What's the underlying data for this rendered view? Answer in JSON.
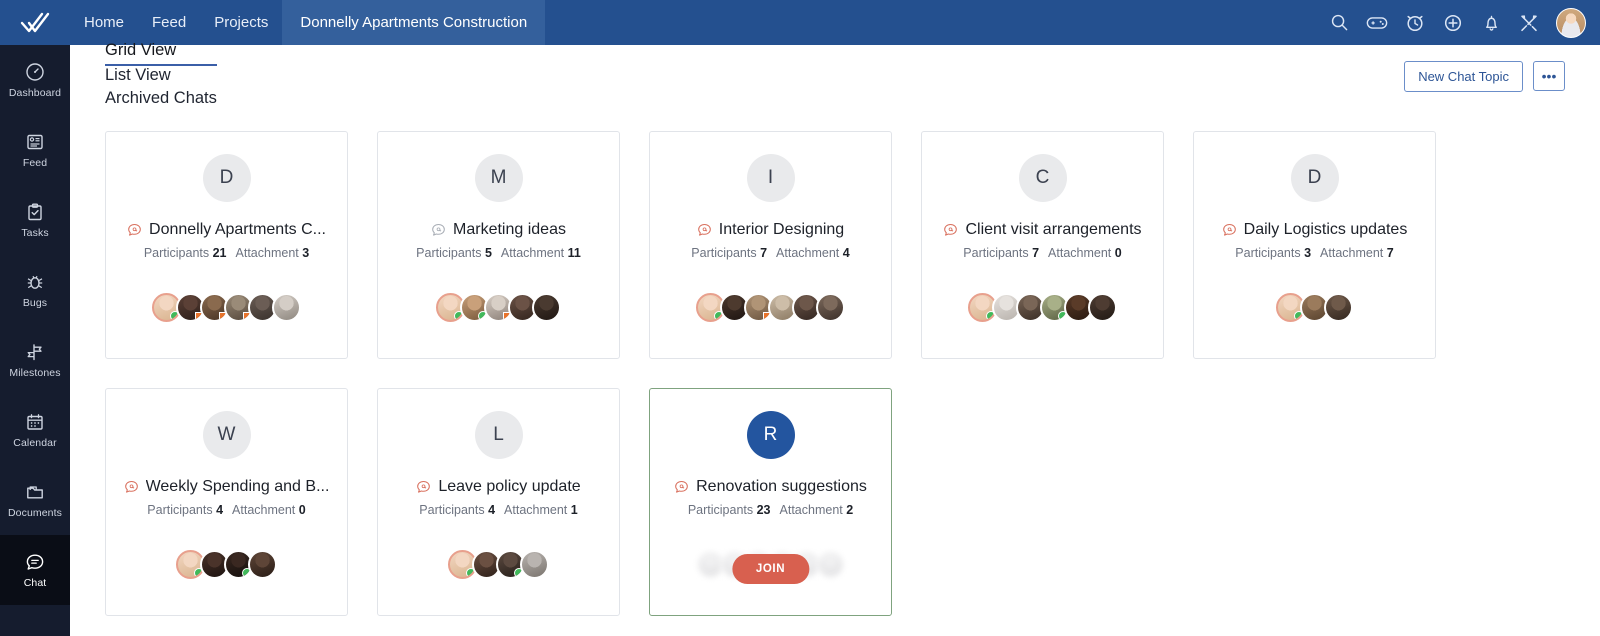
{
  "header": {
    "logo_icon": "double-check-logo",
    "nav": [
      {
        "label": "Home",
        "active": false
      },
      {
        "label": "Feed",
        "active": false
      },
      {
        "label": "Projects",
        "active": false
      },
      {
        "label": "Donnelly Apartments Construction",
        "active": true
      }
    ],
    "icons": [
      {
        "name": "search-icon"
      },
      {
        "name": "game-controller-icon"
      },
      {
        "name": "timer-clock-icon"
      },
      {
        "name": "add-plus-icon"
      },
      {
        "name": "notifications-bell-icon"
      },
      {
        "name": "tools-settings-icon"
      }
    ],
    "avatar_name": "user-avatar",
    "bg_color": "#24508f",
    "active_tab_bg": "#34609c"
  },
  "sidebar": {
    "bg_color": "#151c2e",
    "active_bg": "#0a0d16",
    "items": [
      {
        "label": "Dashboard",
        "icon": "speedometer-icon",
        "active": false
      },
      {
        "label": "Feed",
        "icon": "feed-card-icon",
        "active": false
      },
      {
        "label": "Tasks",
        "icon": "clipboard-check-icon",
        "active": false
      },
      {
        "label": "Bugs",
        "icon": "bug-icon",
        "active": false
      },
      {
        "label": "Milestones",
        "icon": "signpost-icon",
        "active": false
      },
      {
        "label": "Calendar",
        "icon": "calendar-icon",
        "active": false
      },
      {
        "label": "Documents",
        "icon": "folder-icon",
        "active": false
      },
      {
        "label": "Chat",
        "icon": "chat-bubble-icon",
        "active": true
      }
    ]
  },
  "subheader": {
    "tabs": [
      {
        "label": "Grid View",
        "active": true
      },
      {
        "label": "List View",
        "active": false
      },
      {
        "label": "Archived Chats",
        "active": false
      }
    ],
    "new_topic_label": "New Chat Topic",
    "more_label": "•••",
    "accent_color": "#3b5fa8"
  },
  "labels": {
    "participants": "Participants",
    "attachment": "Attachment",
    "join": "JOIN"
  },
  "cards": [
    {
      "initial": "D",
      "title": "Donnelly Apartments C...",
      "participants": "21",
      "attachments": "3",
      "mention_color": "#d9715f",
      "avatar_style": "gray",
      "highlight": false,
      "show_join": false,
      "avatars": [
        {
          "c1": "#f3d7c2",
          "c2": "#d9b48f",
          "ring": true,
          "badge": "dot"
        },
        {
          "c1": "#5b4036",
          "c2": "#2d1f1a",
          "ring": false,
          "badge": "sqr"
        },
        {
          "c1": "#8a6a4e",
          "c2": "#4a3526",
          "ring": false,
          "badge": "sqr"
        },
        {
          "c1": "#9a8b78",
          "c2": "#57493c",
          "ring": false,
          "badge": "sqr"
        },
        {
          "c1": "#6b5d55",
          "c2": "#3a322d",
          "ring": false,
          "badge": "none"
        },
        {
          "c1": "#d4cdc6",
          "c2": "#8f8880",
          "ring": false,
          "badge": "none"
        }
      ]
    },
    {
      "initial": "M",
      "title": "Marketing ideas",
      "participants": "5",
      "attachments": "11",
      "mention_color": "#a9aeb6",
      "avatar_style": "gray",
      "highlight": false,
      "show_join": false,
      "avatars": [
        {
          "c1": "#f3d7c2",
          "c2": "#d9b48f",
          "ring": true,
          "badge": "dot"
        },
        {
          "c1": "#c9a07a",
          "c2": "#7a5a3c",
          "ring": false,
          "badge": "dot"
        },
        {
          "c1": "#d8cfc6",
          "c2": "#8d8179",
          "ring": false,
          "badge": "sqr"
        },
        {
          "c1": "#6b5246",
          "c2": "#33251e",
          "ring": false,
          "badge": "none"
        },
        {
          "c1": "#4a3a30",
          "c2": "#201713",
          "ring": false,
          "badge": "none"
        }
      ]
    },
    {
      "initial": "I",
      "title": "Interior Designing",
      "participants": "7",
      "attachments": "4",
      "mention_color": "#d9715f",
      "avatar_style": "gray",
      "highlight": false,
      "show_join": false,
      "avatars": [
        {
          "c1": "#f3d7c2",
          "c2": "#d9b48f",
          "ring": true,
          "badge": "dot"
        },
        {
          "c1": "#4d3a2e",
          "c2": "#1e1512",
          "ring": false,
          "badge": "none"
        },
        {
          "c1": "#b09476",
          "c2": "#6d5640",
          "ring": false,
          "badge": "sqr"
        },
        {
          "c1": "#cdbda8",
          "c2": "#8d7b64",
          "ring": false,
          "badge": "none"
        },
        {
          "c1": "#6d574a",
          "c2": "#342722",
          "ring": false,
          "badge": "none"
        },
        {
          "c1": "#7d6a5c",
          "c2": "#3c302a",
          "ring": false,
          "badge": "none"
        }
      ]
    },
    {
      "initial": "C",
      "title": "Client visit arrangements",
      "participants": "7",
      "attachments": "0",
      "mention_color": "#d9715f",
      "avatar_style": "gray",
      "highlight": false,
      "show_join": false,
      "avatars": [
        {
          "c1": "#f3d7c2",
          "c2": "#d9b48f",
          "ring": true,
          "badge": "dot"
        },
        {
          "c1": "#e6e2de",
          "c2": "#b9b3ad",
          "ring": false,
          "badge": "none"
        },
        {
          "c1": "#7a6657",
          "c2": "#3b2f27",
          "ring": false,
          "badge": "none"
        },
        {
          "c1": "#a8b088",
          "c2": "#5d6344",
          "ring": false,
          "badge": "dot"
        },
        {
          "c1": "#5a3b28",
          "c2": "#2a1a11",
          "ring": false,
          "badge": "none"
        },
        {
          "c1": "#4e3c32",
          "c2": "#221a15",
          "ring": false,
          "badge": "none"
        }
      ]
    },
    {
      "initial": "D",
      "title": "Daily Logistics updates",
      "participants": "3",
      "attachments": "7",
      "mention_color": "#d9715f",
      "avatar_style": "gray",
      "highlight": false,
      "show_join": false,
      "avatars": [
        {
          "c1": "#f3d7c2",
          "c2": "#d9b48f",
          "ring": true,
          "badge": "dot"
        },
        {
          "c1": "#9b7b5c",
          "c2": "#5a442f",
          "ring": false,
          "badge": "none"
        },
        {
          "c1": "#6f5a4a",
          "c2": "#342820",
          "ring": false,
          "badge": "none"
        }
      ]
    },
    {
      "initial": "W",
      "title": "Weekly Spending and B...",
      "participants": "4",
      "attachments": "0",
      "mention_color": "#d9715f",
      "avatar_style": "gray",
      "highlight": false,
      "show_join": false,
      "avatars": [
        {
          "c1": "#f3d7c2",
          "c2": "#d9b48f",
          "ring": true,
          "badge": "dot"
        },
        {
          "c1": "#4a332a",
          "c2": "#1d1310",
          "ring": false,
          "badge": "none"
        },
        {
          "c1": "#3a2821",
          "c2": "#15100d",
          "ring": false,
          "badge": "dot"
        },
        {
          "c1": "#5e4537",
          "c2": "#2a1d16",
          "ring": false,
          "badge": "none"
        }
      ]
    },
    {
      "initial": "L",
      "title": "Leave policy update",
      "participants": "4",
      "attachments": "1",
      "mention_color": "#d9715f",
      "avatar_style": "gray",
      "highlight": false,
      "show_join": false,
      "avatars": [
        {
          "c1": "#f3d7c2",
          "c2": "#d9b48f",
          "ring": true,
          "badge": "dot"
        },
        {
          "c1": "#6b5042",
          "c2": "#2f211a",
          "ring": false,
          "badge": "none"
        },
        {
          "c1": "#5c4a40",
          "c2": "#28201b",
          "ring": false,
          "badge": "dot"
        },
        {
          "c1": "#b9b4b0",
          "c2": "#7b756f",
          "ring": false,
          "badge": "none"
        }
      ]
    },
    {
      "initial": "R",
      "title": "Renovation suggestions",
      "participants": "23",
      "attachments": "2",
      "mention_color": "#d9715f",
      "avatar_style": "blue",
      "highlight": true,
      "show_join": true,
      "avatars": [
        {
          "c1": "#e4e4e6",
          "c2": "#cfcfd2",
          "ring": false,
          "badge": "none"
        },
        {
          "c1": "#e4e4e6",
          "c2": "#cfcfd2",
          "ring": false,
          "badge": "none"
        },
        {
          "c1": "#e4e4e6",
          "c2": "#cfcfd2",
          "ring": false,
          "badge": "none"
        },
        {
          "c1": "#e4e4e6",
          "c2": "#cfcfd2",
          "ring": false,
          "badge": "none"
        },
        {
          "c1": "#e4e4e6",
          "c2": "#cfcfd2",
          "ring": false,
          "badge": "none"
        },
        {
          "c1": "#e4e4e6",
          "c2": "#cfcfd2",
          "ring": false,
          "badge": "none"
        }
      ]
    }
  ]
}
